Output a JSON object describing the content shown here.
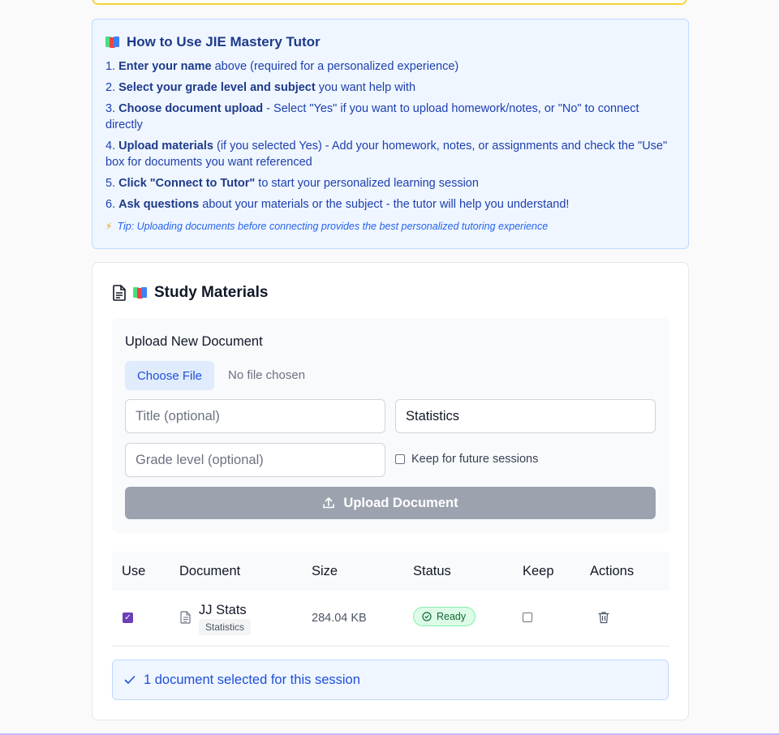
{
  "howto": {
    "title": "How to Use JIE Mastery Tutor",
    "steps": [
      {
        "num": "1.",
        "bold": "Enter your name",
        "rest": " above (required for a personalized experience)"
      },
      {
        "num": "2.",
        "bold": "Select your grade level and subject",
        "rest": " you want help with"
      },
      {
        "num": "3.",
        "bold": "Choose document upload",
        "rest": " - Select \"Yes\" if you want to upload homework/notes, or \"No\" to connect directly"
      },
      {
        "num": "4.",
        "bold": "Upload materials",
        "rest": " (if you selected Yes) - Add your homework, notes, or assignments and check the \"Use\" box for documents you want referenced"
      },
      {
        "num": "5.",
        "bold": "Click \"Connect to Tutor\"",
        "rest": " to start your personalized learning session"
      },
      {
        "num": "6.",
        "bold": "Ask questions",
        "rest": " about your materials or the subject - the tutor will help you understand!"
      }
    ],
    "tip": "Tip: Uploading documents before connecting provides the best personalized tutoring experience"
  },
  "materials": {
    "title": "Study Materials",
    "upload": {
      "heading": "Upload New Document",
      "choose_file_label": "Choose File",
      "no_file_text": "No file chosen",
      "title_placeholder": "Title (optional)",
      "subject_value": "Statistics",
      "grade_placeholder": "Grade level (optional)",
      "keep_label": "Keep for future sessions",
      "upload_button_label": "Upload Document"
    },
    "table": {
      "headers": {
        "use": "Use",
        "document": "Document",
        "size": "Size",
        "status": "Status",
        "keep": "Keep",
        "actions": "Actions"
      },
      "rows": [
        {
          "name": "JJ Stats",
          "tag": "Statistics",
          "size": "284.04 KB",
          "status": "Ready",
          "use": true,
          "keep": false
        }
      ]
    },
    "selected_note": "1 document selected for this session"
  },
  "colors": {
    "accent": "#1d4ed8",
    "checkbox_checked": "#6d3fb8",
    "ready_green": "#166534"
  }
}
